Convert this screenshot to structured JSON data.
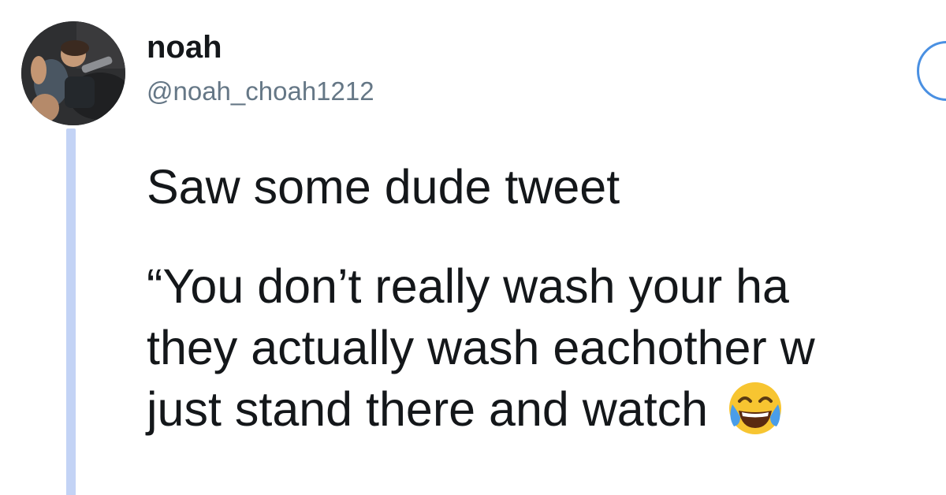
{
  "author": {
    "display_name": "noah",
    "handle": "@noah_choah1212"
  },
  "tweet": {
    "line1": "Saw some dude tweet",
    "line2": "“You don’t really wash your ha",
    "line3": "they actually wash eachother w",
    "line4": "just stand there and watch ",
    "emoji": "face-with-tears-of-joy-emoji"
  },
  "colors": {
    "thread_line": "#c3d3f5",
    "follow_border": "#4a90e2",
    "handle_text": "#657786"
  }
}
